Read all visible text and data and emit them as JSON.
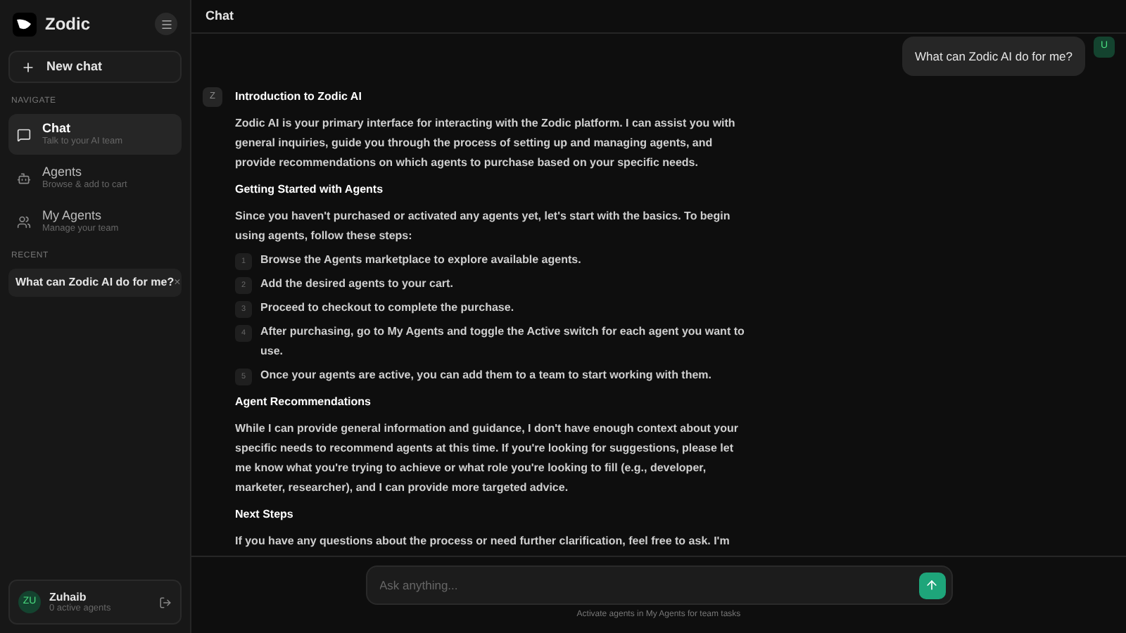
{
  "brand": {
    "name": "Zodic"
  },
  "new_chat": "New chat",
  "nav_label": "NAVIGATE",
  "nav": [
    {
      "kind": "chat",
      "title": "Chat",
      "subtitle": "Talk to your AI team",
      "selected": true
    },
    {
      "kind": "agents",
      "title": "Agents",
      "subtitle": "Browse & add to cart",
      "selected": false
    },
    {
      "kind": "team",
      "title": "My Agents",
      "subtitle": "Manage your team",
      "selected": false
    }
  ],
  "recent_label": "RECENT",
  "recent": [
    {
      "title": "What can Zodic AI do for me?",
      "close": "×"
    }
  ],
  "user": {
    "initials": "ZU",
    "name": "Zuhaib",
    "status": "0 active agents"
  },
  "header": {
    "title": "Chat"
  },
  "user_message": {
    "text": "What can Zodic AI do for me?",
    "avatar": "U"
  },
  "assistant": {
    "avatar": "Z",
    "blocks": [
      {
        "kind": "heading",
        "text": "Introduction to Zodic AI"
      },
      {
        "kind": "paragraph",
        "text": "Zodic AI is your primary interface for interacting with the Zodic platform. I can assist you with general inquiries, guide you through the process of setting up and managing agents, and provide recommendations on which agents to purchase based on your specific needs."
      },
      {
        "kind": "heading",
        "text": "Getting Started with Agents"
      },
      {
        "kind": "paragraph",
        "text": "Since you haven't purchased or activated any agents yet, let's start with the basics. To begin using agents, follow these steps:"
      },
      {
        "kind": "steps",
        "items": [
          {
            "number": "1",
            "text": "Browse the Agents marketplace to explore available agents."
          },
          {
            "number": "2",
            "text": "Add the desired agents to your cart."
          },
          {
            "number": "3",
            "text": "Proceed to checkout to complete the purchase."
          },
          {
            "number": "4",
            "text": "After purchasing, go to My Agents and toggle the Active switch for each agent you want to use."
          },
          {
            "number": "5",
            "text": "Once your agents are active, you can add them to a team to start working with them."
          }
        ]
      },
      {
        "kind": "heading",
        "text": "Agent Recommendations"
      },
      {
        "kind": "paragraph",
        "text": "While I can provide general information and guidance, I don't have enough context about your specific needs to recommend agents at this time. If you're looking for suggestions, please let me know what you're trying to achieve or what role you're looking to fill (e.g., developer, marketer, researcher), and I can provide more targeted advice."
      },
      {
        "kind": "heading",
        "text": "Next Steps"
      },
      {
        "kind": "paragraph",
        "text": "If you have any questions about the process or need further clarification, feel free to ask. I'm"
      }
    ]
  },
  "composer": {
    "placeholder": "Ask anything...",
    "hint": "Activate agents in My Agents for team tasks"
  }
}
